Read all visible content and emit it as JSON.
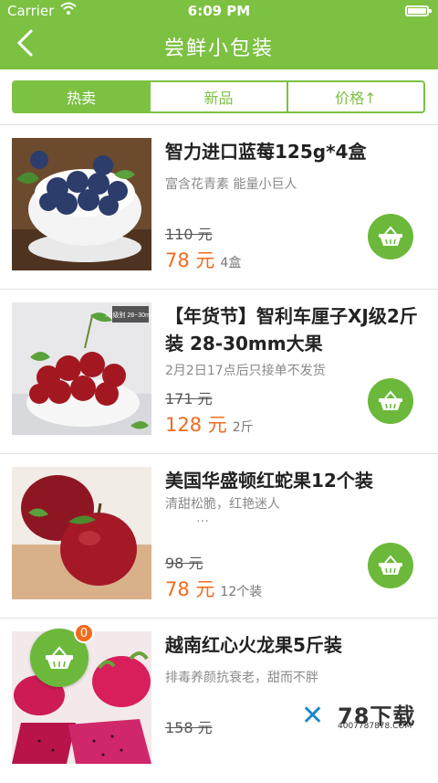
{
  "status_bar": {
    "carrier": "Carrier",
    "time": "6:09 PM"
  },
  "nav": {
    "back_glyph": "〈",
    "title": "尝鲜小包装"
  },
  "tabs": [
    {
      "label": "热卖",
      "active": true
    },
    {
      "label": "新品",
      "active": false
    },
    {
      "label": "价格↑",
      "active": false
    }
  ],
  "products": [
    {
      "name": "智力进口蓝莓125g*4盒",
      "subtitle": "富含花青素 能量小巨人",
      "old_price": "110 元",
      "price": "78 元",
      "unit": "4盒",
      "image": "blueberries"
    },
    {
      "name": "【年货节】智利车厘子XJ级2斤装 28-30mm大果",
      "subtitle": "2月2日17点后只接单不发货",
      "old_price": "171 元",
      "price": "128 元",
      "unit": "2斤",
      "image": "cherries",
      "image_tag": "XJ级别 28~30mm"
    },
    {
      "name": "美国华盛顿红蛇果12个装",
      "subtitle": "清甜松脆，红艳迷人",
      "extra": "…",
      "old_price": "98 元",
      "price": "78 元",
      "unit": "12个装",
      "image": "red-apples"
    },
    {
      "name": "越南红心火龙果5斤装",
      "subtitle": "排毒养颜抗衰老，甜而不胖",
      "old_price": "158 元",
      "image": "dragon-fruit"
    }
  ],
  "cart": {
    "count": "0",
    "icon": "basket-icon"
  },
  "watermark": {
    "title": "78下载",
    "phone": "4007787878.COM"
  },
  "colors": {
    "brand_green": "#7cc142",
    "price_orange": "#f26b1d"
  }
}
